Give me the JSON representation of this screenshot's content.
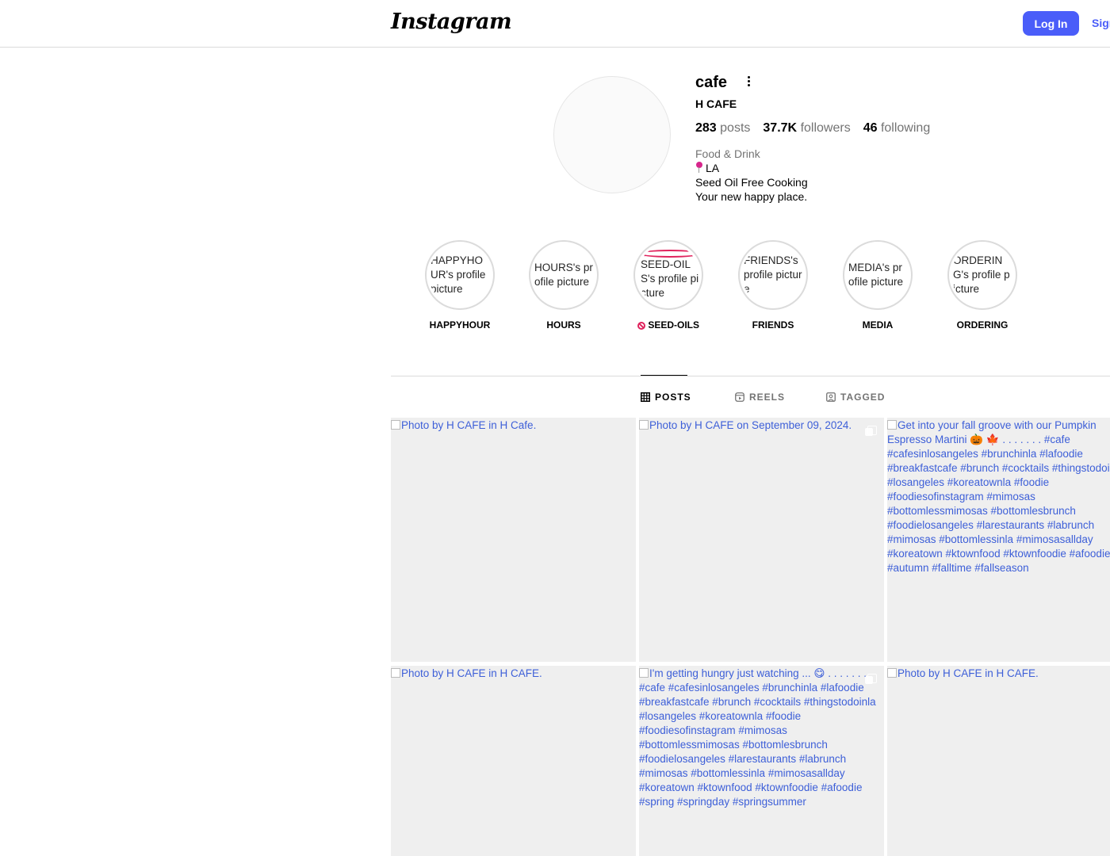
{
  "header": {
    "logo": "Instagram",
    "login_label": "Log In",
    "signup_label": "Sign Up"
  },
  "profile": {
    "username": "cafe",
    "full_name": "H CAFE",
    "posts_count": "283",
    "posts_label": "posts",
    "followers_count": "37.7K",
    "followers_label": "followers",
    "following_count": "46",
    "following_label": "following",
    "category": "Food & Drink",
    "location": "LA",
    "bio_line1": "Seed Oil Free Cooking",
    "bio_line2": "Your new happy place."
  },
  "highlights": [
    {
      "alt": "HAPPYHOUR's profile picture",
      "label": "HAPPYHOUR"
    },
    {
      "alt": "HOURS's profile picture",
      "label": "HOURS"
    },
    {
      "alt": "SEED-OILS's profile picture",
      "label": "SEED-OILS"
    },
    {
      "alt": "FRIENDS's profile picture",
      "label": "FRIENDS"
    },
    {
      "alt": "MEDIA's profile picture",
      "label": "MEDIA"
    },
    {
      "alt": "ORDERING's profile picture",
      "label": "ORDERING"
    }
  ],
  "tabs": [
    {
      "label": "POSTS",
      "icon": "grid-icon",
      "active": true
    },
    {
      "label": "REELS",
      "icon": "reels-icon",
      "active": false
    },
    {
      "label": "TAGGED",
      "icon": "tagged-icon",
      "active": false
    }
  ],
  "posts": [
    {
      "alt": "Photo by H CAFE in H Cafe."
    },
    {
      "alt": "Photo by H CAFE on September 09, 2024."
    },
    {
      "alt": "Get into your fall groove with our Pumpkin Espresso Martini 🎃 🍁 . . . . . . . #cafe #cafesinlosangeles #brunchinla #lafoodie #breakfastcafe #brunch #cocktails #thingstodoinla #losangeles #koreatownla #foodie #foodiesofinstagram #mimosas #bottomlessmimosas #bottomlesbrunch #foodielosangeles #larestaurants #labrunch #mimosas #bottomlessinla #mimosasallday #koreatown #ktownfood #ktownfoodie #afoodie #autumn #falltime #fallseason"
    },
    {
      "alt": "Photo by H CAFE in H CAFE."
    },
    {
      "alt": "I'm getting hungry just watching ... 😋 . . . . . . . #cafe #cafesinlosangeles #brunchinla #lafoodie #breakfastcafe #brunch #cocktails #thingstodoinla #losangeles #koreatownla #foodie #foodiesofinstagram #mimosas #bottomlessmimosas #bottomlesbrunch #foodielosangeles #larestaurants #labrunch #mimosas #bottomlessinla #mimosasallday #koreatown #ktownfood #ktownfoodie #afoodie #spring #springday #springsummer"
    },
    {
      "alt": "Photo by H CAFE in H CAFE."
    }
  ]
}
